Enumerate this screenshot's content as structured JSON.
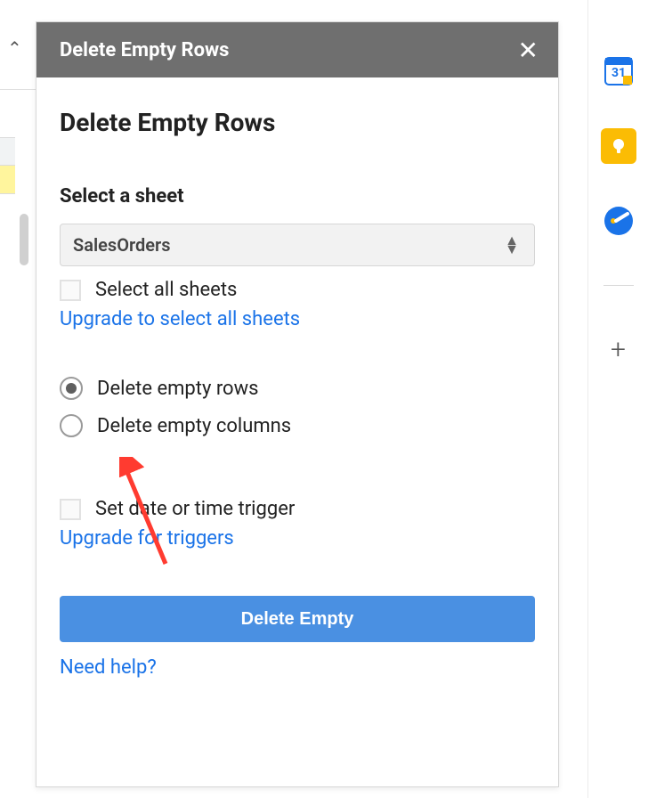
{
  "header": {
    "title": "Delete Empty Rows"
  },
  "main": {
    "title": "Delete Empty Rows",
    "select_sheet_label": "Select a sheet",
    "sheet_dropdown_value": "SalesOrders",
    "select_all_label": "Select all sheets",
    "upgrade_sheets_link": "Upgrade to select all sheets",
    "radio_rows_label": "Delete empty rows",
    "radio_cols_label": "Delete empty columns",
    "trigger_label": "Set date or time trigger",
    "upgrade_triggers_link": "Upgrade for triggers",
    "primary_button": "Delete Empty",
    "help_link": "Need help?"
  },
  "state": {
    "selected_radio": "rows",
    "select_all_checked": false,
    "trigger_checked": false
  },
  "colors": {
    "link": "#1a73e8",
    "primary": "#4a90e2",
    "header_bg": "#6f6f6f",
    "arrow": "#ff3b30"
  }
}
